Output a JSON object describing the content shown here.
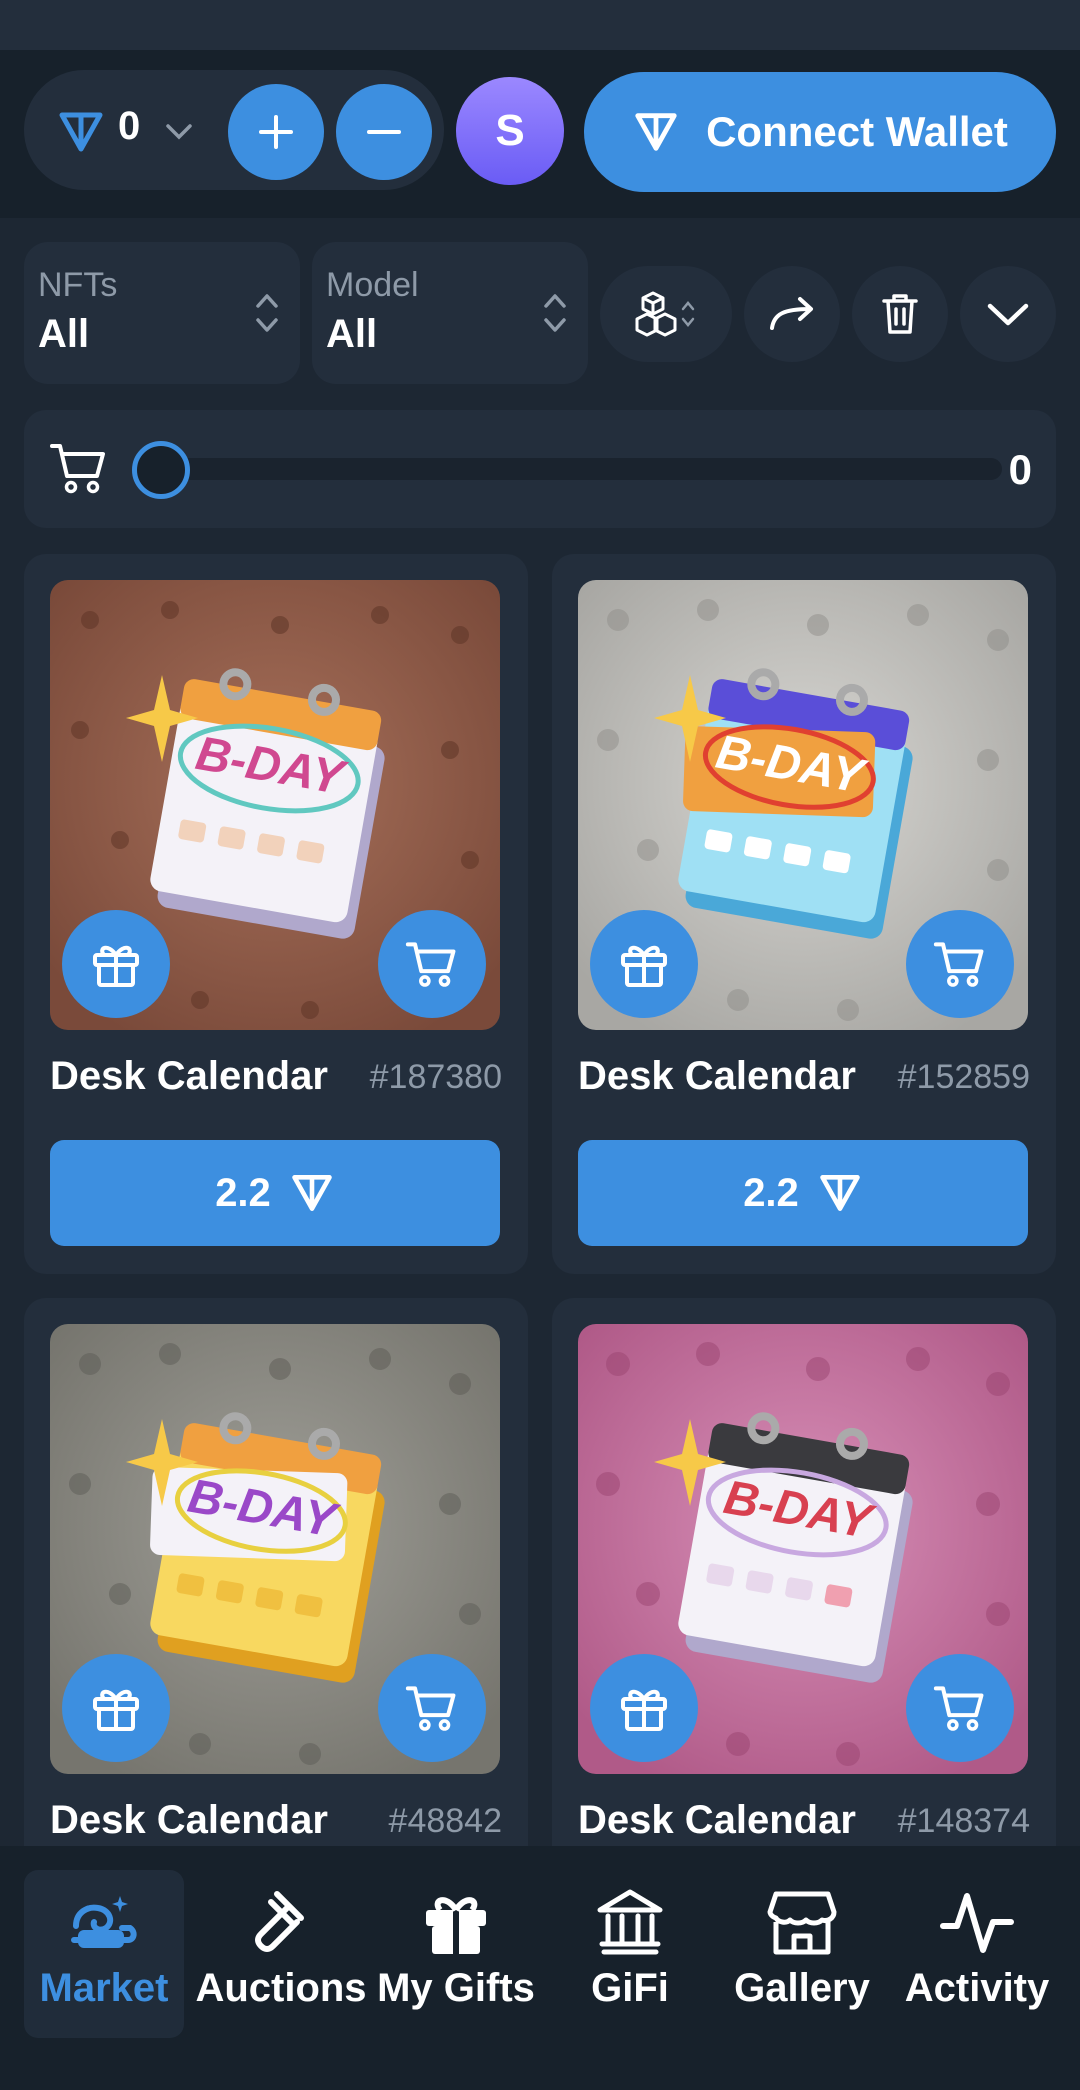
{
  "header": {
    "balance": "0",
    "avatar_letter": "S",
    "connect_wallet_label": "Connect Wallet"
  },
  "filters": {
    "nfts": {
      "label": "NFTs",
      "value": "All"
    },
    "model": {
      "label": "Model",
      "value": "All"
    }
  },
  "cart": {
    "count": "0",
    "slider_value": 0
  },
  "cards": [
    {
      "name": "Desk Calendar",
      "number": "#187380",
      "price": "2.2",
      "background": "#8a5a48",
      "pattern": "paw"
    },
    {
      "name": "Desk Calendar",
      "number": "#152859",
      "price": "2.2",
      "background": "#c4c3bf",
      "pattern": "bat"
    },
    {
      "name": "Desk Calendar",
      "number": "#48842",
      "background": "#8b8a83",
      "pattern": "apple"
    },
    {
      "name": "Desk Calendar",
      "number": "#148374",
      "background": "#c4709c",
      "pattern": "hippo"
    }
  ],
  "nav": [
    {
      "label": "Market",
      "icon": "market-snail-icon",
      "active": true
    },
    {
      "label": "Auctions",
      "icon": "gavel-icon"
    },
    {
      "label": "My Gifts",
      "icon": "gift-icon"
    },
    {
      "label": "GiFi",
      "icon": "bank-icon"
    },
    {
      "label": "Gallery",
      "icon": "storefront-icon"
    },
    {
      "label": "Activity",
      "icon": "activity-pulse-icon"
    }
  ],
  "colors": {
    "accent": "#3d8fe0",
    "background": "#1d2733",
    "panel": "#232e3c",
    "muted": "#8e9aa8"
  }
}
